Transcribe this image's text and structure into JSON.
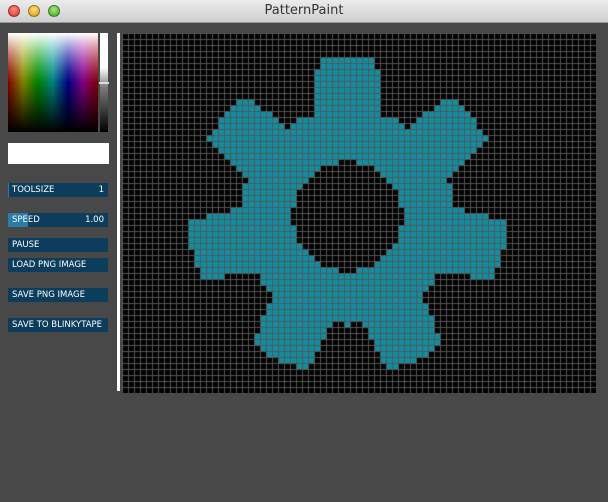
{
  "window": {
    "title": "PatternPaint"
  },
  "controls": {
    "toolsize": {
      "label": "TOOLSIZE",
      "value": "1",
      "level": 0.01
    },
    "speed": {
      "label": "SPEED",
      "value": "1.00",
      "level": 0.2
    },
    "pause": {
      "label": "PAUSE"
    },
    "load_png": {
      "label": "LOAD PNG IMAGE"
    },
    "save_png": {
      "label": "SAVE PNG IMAGE"
    },
    "save_blinky": {
      "label": "SAVE TO BLINKYTAPE"
    }
  },
  "picker": {
    "selected_color": "#ffffff",
    "brightness_level": 0.5
  },
  "canvas": {
    "columns": 79,
    "rows": 60,
    "background_color": "#000000",
    "grid_color": "#555555",
    "fill_color": "#0f8fa2",
    "shape": "gear"
  }
}
